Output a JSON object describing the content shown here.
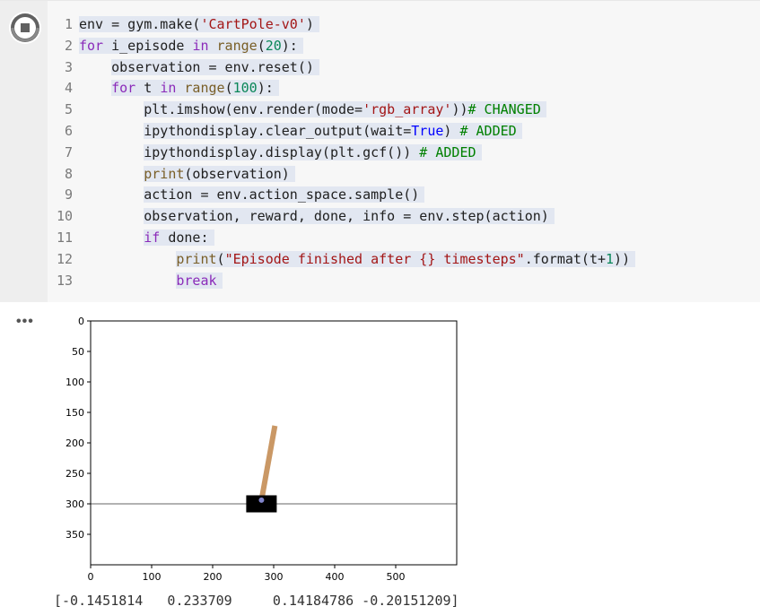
{
  "cell": {
    "run_button_icon": "stop-run-icon",
    "line_numbers": [
      "1",
      "2",
      "3",
      "4",
      "5",
      "6",
      "7",
      "8",
      "9",
      "10",
      "11",
      "12",
      "13"
    ]
  },
  "code_lines": [
    "env = gym.make('CartPole-v0')",
    "for i_episode in range(20):",
    "    observation = env.reset()",
    "    for t in range(100):",
    "        plt.imshow(env.render(mode='rgb_array'))# CHANGED",
    "        ipythondisplay.clear_output(wait=True) # ADDED",
    "        ipythondisplay.display(plt.gcf()) # ADDED",
    "        print(observation)",
    "        action = env.action_space.sample()",
    "        observation, reward, done, info = env.step(action)",
    "        if done:",
    "            print(\"Episode finished after {} timesteps\".format(t+1))",
    "            break"
  ],
  "output": {
    "menu_icon": "•••",
    "printed_text": "[-0.1451814   0.233709     0.14184786 -0.20151209]"
  },
  "chart_data": {
    "type": "image",
    "x_ticks": [
      0,
      100,
      200,
      300,
      400,
      500
    ],
    "y_ticks": [
      0,
      50,
      100,
      150,
      200,
      250,
      300,
      350
    ],
    "xlim": [
      0,
      600
    ],
    "ylim": [
      400,
      0
    ],
    "track_y": 300,
    "cart": {
      "x_center": 280,
      "y_center": 300
    },
    "pole_top": {
      "x": 302,
      "y": 172
    },
    "colors": {
      "cart": "#000000",
      "pole": "#ca9865",
      "track": "#999999"
    }
  }
}
